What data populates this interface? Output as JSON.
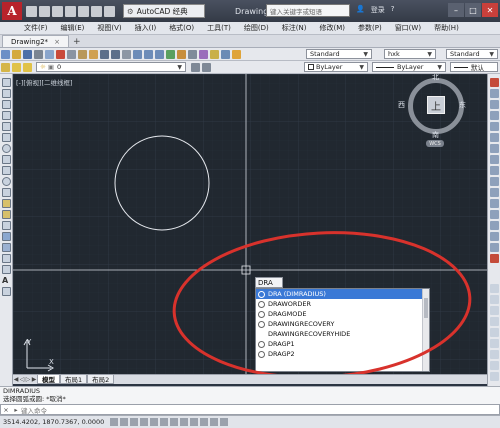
{
  "titlebar": {
    "app_logo": "A",
    "workspace": "AutoCAD 经典",
    "title": "Drawing2.dwg",
    "search_placeholder": "键入关键字或短语",
    "login": "登录",
    "window_controls": [
      "–",
      "□",
      "✕"
    ]
  },
  "menu": [
    "文件(F)",
    "编辑(E)",
    "视图(V)",
    "插入(I)",
    "格式(O)",
    "工具(T)",
    "绘图(D)",
    "标注(N)",
    "修改(M)",
    "参数(P)",
    "窗口(W)",
    "帮助(H)"
  ],
  "file_tab": {
    "label": "Drawing2*",
    "close": "×",
    "add": "+"
  },
  "toolbar1": {
    "text_style": "Standard",
    "dim_style": "hxk",
    "table_style": "Standard",
    "mleader_style": "Standard"
  },
  "toolbar2": {
    "layer": "0",
    "color": "ByLayer",
    "linetype": "ByLayer",
    "plotstyle": "默认"
  },
  "canvas": {
    "view_label": "[-][俯视][二维线框]",
    "navcube": {
      "north": "北",
      "south": "南",
      "east": "东",
      "west": "西",
      "face": "上",
      "wcs": "WCS"
    },
    "ucs": {
      "x": "X",
      "y": "Y"
    }
  },
  "autocomplete": {
    "typed": "DRA",
    "items": [
      {
        "label": "DRA (DIMRADIUS)",
        "selected": true,
        "icon": "dim-radius-icon"
      },
      {
        "label": "DRAWORDER",
        "selected": false,
        "icon": "draworder-icon"
      },
      {
        "label": "DRAGMODE",
        "selected": false,
        "icon": "gear-icon"
      },
      {
        "label": "DRAWINGRECOVERY",
        "selected": false,
        "icon": "recovery-icon"
      },
      {
        "label": "DRAWINGRECOVERYHIDE",
        "selected": false,
        "icon": "blank-icon"
      },
      {
        "label": "DRAGP1",
        "selected": false,
        "icon": "gear-icon"
      },
      {
        "label": "DRAGP2",
        "selected": false,
        "icon": "gear-icon"
      }
    ]
  },
  "layout_tabs": [
    {
      "label": "模型",
      "active": true
    },
    {
      "label": "布局1",
      "active": false
    },
    {
      "label": "布局2",
      "active": false
    }
  ],
  "command": {
    "history": [
      "DIMRADIUS",
      "选择圆弧或圆: *取消*"
    ],
    "prompt": "键入命令"
  },
  "status": {
    "coords": "3514.4202, 1870.7367, 0.0000"
  },
  "colors": {
    "canvas_bg": "#212830",
    "annotation": "#d8322c",
    "selection": "#3a79d6"
  }
}
